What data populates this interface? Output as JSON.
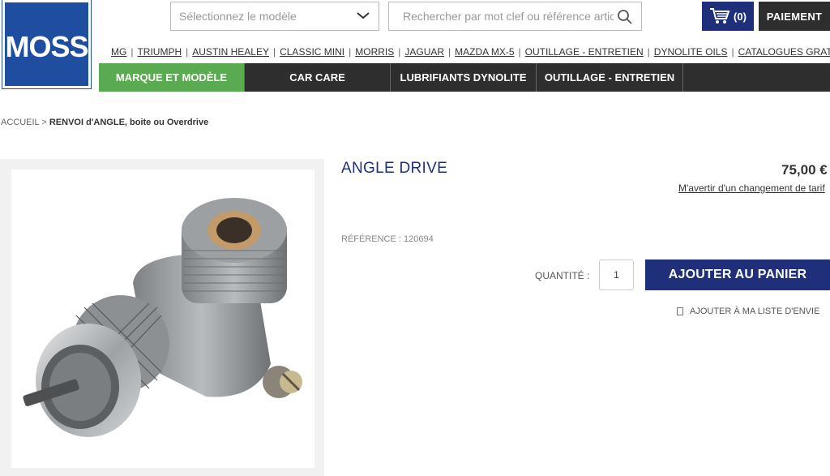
{
  "logo": {
    "text": "MOSS"
  },
  "header": {
    "model_select": {
      "value": "Sélectionnez le modèle"
    },
    "search": {
      "placeholder": "Rechercher par mot clef ou référence article"
    },
    "cart": {
      "count": "(0)"
    },
    "checkout_label": "PAIEMENT"
  },
  "brands": [
    "MG",
    "TRIUMPH",
    "AUSTIN HEALEY",
    "CLASSIC MINI",
    "MORRIS",
    "JAGUAR",
    "MAZDA MX-5",
    "OUTILLAGE - ENTRETIEN",
    "DYNOLITE OILS",
    "CATALOGUES GRATUITS"
  ],
  "nav": [
    "MARQUE ET MODÈLE",
    "CAR CARE",
    "LUBRIFIANTS DYNOLITE",
    "OUTILLAGE - ENTRETIEN"
  ],
  "breadcrumb": {
    "home": "ACCUEIL",
    "sep": ">",
    "current": "RENVOI d'ANGLE, boite ou Overdrive"
  },
  "product": {
    "title": "ANGLE DRIVE",
    "price": "75,00 €",
    "price_alert": "M'avertir d'un changement de tarif",
    "reference": "RÉFÉRENCE : 120694",
    "quantity_label": "QUANTITÉ :",
    "quantity_value": "1",
    "add_to_cart": "AJOUTER AU PANIER",
    "wishlist": "AJOUTER À MA LISTE D'ENVIE"
  },
  "colors": {
    "brand_blue": "#1f2f7a",
    "logo_blue": "#1f4ea1",
    "active_nav": "#5aaa52",
    "dark": "#2e2e2e"
  }
}
